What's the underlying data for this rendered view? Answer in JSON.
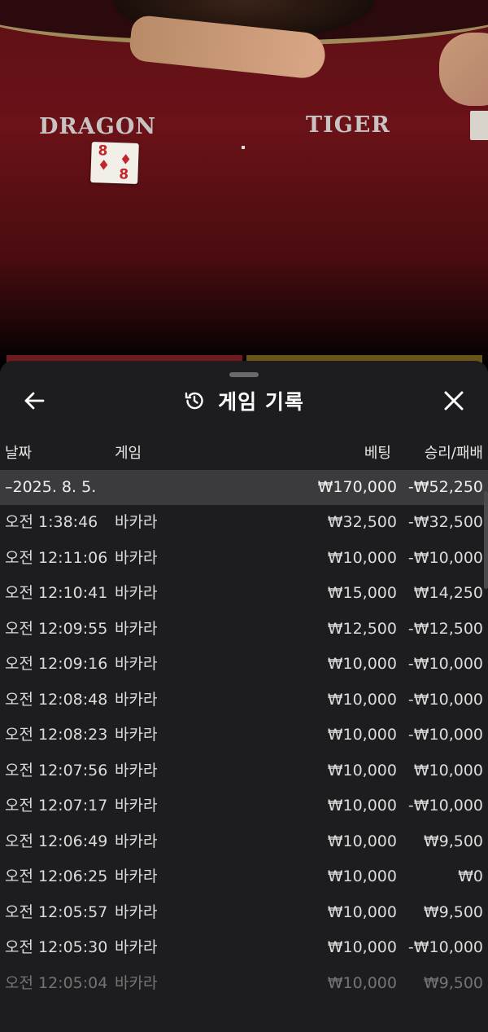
{
  "table": {
    "labels": {
      "dragon": "DRAGON",
      "tiger": "TIGER"
    },
    "card": {
      "rank": "8",
      "suit": "♦"
    },
    "colors": {
      "felt": "#6a1218",
      "card_red": "#c0282d"
    }
  },
  "header": {
    "title": "게임 기록",
    "back_icon": "arrow-left-icon",
    "history_icon": "history-icon",
    "close_icon": "close-icon"
  },
  "columns": {
    "date": "날짜",
    "game": "게임",
    "bet": "베팅",
    "result": "승리/패배"
  },
  "summary": {
    "date": "–2025. 8. 5.",
    "bet": "₩170,000",
    "result": "-₩52,250"
  },
  "rows": [
    {
      "time": "오전 1:38:46",
      "game": "바카라",
      "bet": "₩32,500",
      "result": "-₩32,500"
    },
    {
      "time": "오전 12:11:06",
      "game": "바카라",
      "bet": "₩10,000",
      "result": "-₩10,000"
    },
    {
      "time": "오전 12:10:41",
      "game": "바카라",
      "bet": "₩15,000",
      "result": "₩14,250"
    },
    {
      "time": "오전 12:09:55",
      "game": "바카라",
      "bet": "₩12,500",
      "result": "-₩12,500"
    },
    {
      "time": "오전 12:09:16",
      "game": "바카라",
      "bet": "₩10,000",
      "result": "-₩10,000"
    },
    {
      "time": "오전 12:08:48",
      "game": "바카라",
      "bet": "₩10,000",
      "result": "-₩10,000"
    },
    {
      "time": "오전 12:08:23",
      "game": "바카라",
      "bet": "₩10,000",
      "result": "-₩10,000"
    },
    {
      "time": "오전 12:07:56",
      "game": "바카라",
      "bet": "₩10,000",
      "result": "₩10,000"
    },
    {
      "time": "오전 12:07:17",
      "game": "바카라",
      "bet": "₩10,000",
      "result": "-₩10,000"
    },
    {
      "time": "오전 12:06:49",
      "game": "바카라",
      "bet": "₩10,000",
      "result": "₩9,500"
    },
    {
      "time": "오전 12:06:25",
      "game": "바카라",
      "bet": "₩10,000",
      "result": "₩0"
    },
    {
      "time": "오전 12:05:57",
      "game": "바카라",
      "bet": "₩10,000",
      "result": "₩9,500"
    },
    {
      "time": "오전 12:05:30",
      "game": "바카라",
      "bet": "₩10,000",
      "result": "-₩10,000"
    },
    {
      "time": "오전 12:05:04",
      "game": "바카라",
      "bet": "₩10,000",
      "result": "₩9,500"
    }
  ]
}
